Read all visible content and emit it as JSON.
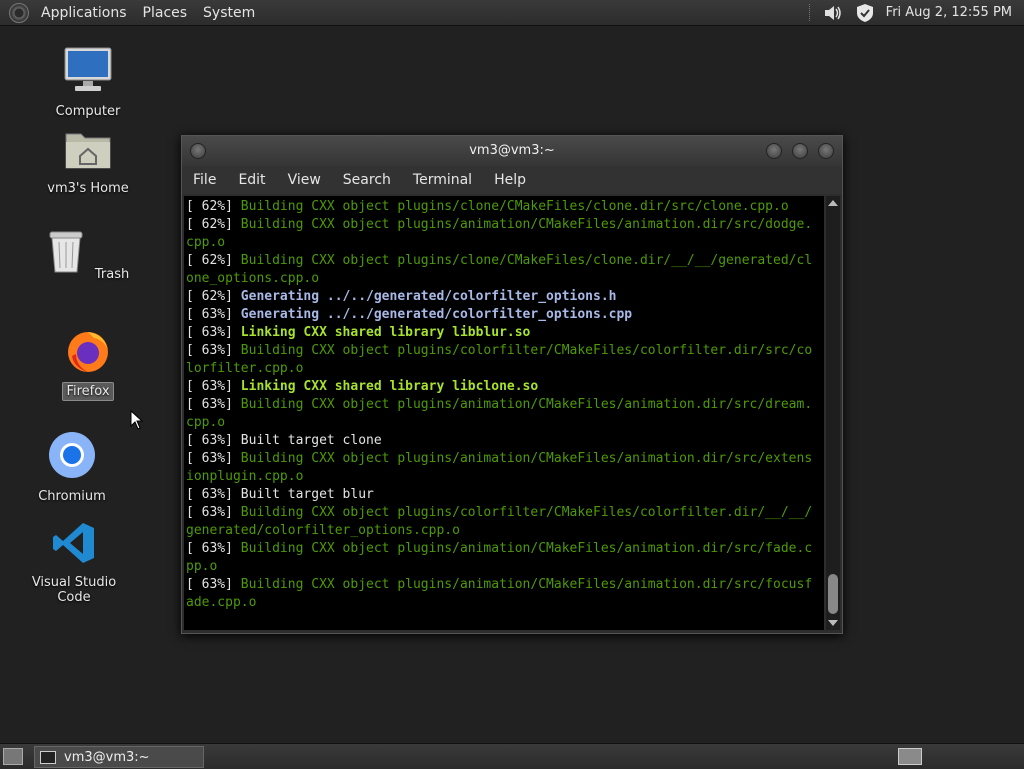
{
  "top_panel": {
    "menus": [
      "Applications",
      "Places",
      "System"
    ],
    "clock": "Fri Aug  2, 12:55 PM",
    "icons": [
      "menu-logo-icon",
      "volume-icon",
      "shield-check-icon"
    ]
  },
  "desktop": {
    "icons": [
      {
        "label": "Computer",
        "icon": "monitor-icon"
      },
      {
        "label": "vm3's Home",
        "icon": "home-folder-icon"
      },
      {
        "label": "Trash",
        "icon": "trash-icon"
      },
      {
        "label": "Firefox",
        "icon": "firefox-icon"
      },
      {
        "label": "Chromium",
        "icon": "chromium-icon"
      },
      {
        "label": "Visual Studio Code",
        "icon": "vscode-icon"
      }
    ]
  },
  "window": {
    "title": "vm3@vm3:~",
    "menus": [
      "File",
      "Edit",
      "View",
      "Search",
      "Terminal",
      "Help"
    ]
  },
  "terminal": {
    "lines": [
      {
        "pct": "[ 62%] ",
        "text": "Building CXX object plugins/clone/CMakeFiles/clone.dir/src/clone.cpp.o",
        "style": "g"
      },
      {
        "pct": "[ 62%] ",
        "text": "Building CXX object plugins/animation/CMakeFiles/animation.dir/src/dodge.",
        "style": "g"
      },
      {
        "pct": "",
        "text": "cpp.o",
        "style": "g"
      },
      {
        "pct": "[ 62%] ",
        "text": "Building CXX object plugins/clone/CMakeFiles/clone.dir/__/__/generated/cl",
        "style": "g"
      },
      {
        "pct": "",
        "text": "one_options.cpp.o",
        "style": "g"
      },
      {
        "pct": "[ 62%] ",
        "text": "Generating ../../generated/colorfilter_options.h",
        "style": "b"
      },
      {
        "pct": "[ 63%] ",
        "text": "Generating ../../generated/colorfilter_options.cpp",
        "style": "b"
      },
      {
        "pct": "[ 63%] ",
        "text": "Linking CXX shared library libblur.so",
        "style": "lg"
      },
      {
        "pct": "[ 63%] ",
        "text": "Building CXX object plugins/colorfilter/CMakeFiles/colorfilter.dir/src/co",
        "style": "g"
      },
      {
        "pct": "",
        "text": "lorfilter.cpp.o",
        "style": "g"
      },
      {
        "pct": "[ 63%] ",
        "text": "Linking CXX shared library libclone.so",
        "style": "lg"
      },
      {
        "pct": "[ 63%] ",
        "text": "Building CXX object plugins/animation/CMakeFiles/animation.dir/src/dream.",
        "style": "g"
      },
      {
        "pct": "",
        "text": "cpp.o",
        "style": "g"
      },
      {
        "pct": "[ 63%] ",
        "text": "Built target clone",
        "style": "w"
      },
      {
        "pct": "[ 63%] ",
        "text": "Building CXX object plugins/animation/CMakeFiles/animation.dir/src/extens",
        "style": "g"
      },
      {
        "pct": "",
        "text": "ionplugin.cpp.o",
        "style": "g"
      },
      {
        "pct": "[ 63%] ",
        "text": "Built target blur",
        "style": "w"
      },
      {
        "pct": "[ 63%] ",
        "text": "Building CXX object plugins/colorfilter/CMakeFiles/colorfilter.dir/__/__/",
        "style": "g"
      },
      {
        "pct": "",
        "text": "generated/colorfilter_options.cpp.o",
        "style": "g"
      },
      {
        "pct": "[ 63%] ",
        "text": "Building CXX object plugins/animation/CMakeFiles/animation.dir/src/fade.c",
        "style": "g"
      },
      {
        "pct": "",
        "text": "pp.o",
        "style": "g"
      },
      {
        "pct": "[ 63%] ",
        "text": "Building CXX object plugins/animation/CMakeFiles/animation.dir/src/focusf",
        "style": "g"
      },
      {
        "pct": "",
        "text": "ade.cpp.o",
        "style": "g"
      }
    ]
  },
  "taskbar": {
    "task_label": "vm3@vm3:~"
  }
}
